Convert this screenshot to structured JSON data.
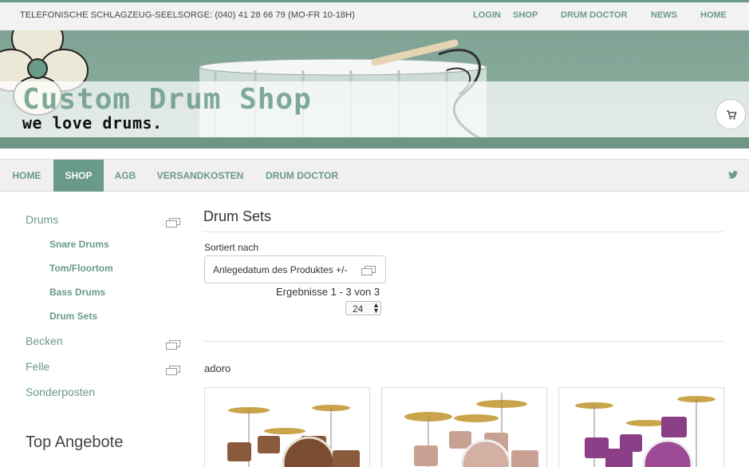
{
  "topbar": {
    "phone": "TELEFONISCHE SCHLAGZEUG-SEELSORGE: (040) 41 28 66 79 (MO-FR 10-18H)",
    "links": [
      "LOGIN",
      "SHOP",
      "DRUM DOCTOR",
      "NEWS",
      "HOME"
    ]
  },
  "banner": {
    "title": "Custom Drum Shop",
    "tagline": "we love drums."
  },
  "mainnav": {
    "items": [
      "HOME",
      "SHOP",
      "AGB",
      "VERSANDKOSTEN",
      "DRUM DOCTOR"
    ],
    "active": "SHOP"
  },
  "sidebar": {
    "categories": [
      {
        "label": "Drums",
        "children": [
          "Snare Drums",
          "Tom/Floortom",
          "Bass Drums",
          "Drum Sets"
        ]
      },
      {
        "label": "Becken"
      },
      {
        "label": "Felle"
      },
      {
        "label": "Sonderposten"
      }
    ],
    "top_offers_heading": "Top Angebote"
  },
  "main": {
    "heading": "Drum Sets",
    "sort_label": "Sortiert nach",
    "sort_value": "Anlegedatum des Produktes +/-",
    "results_text": "Ergebnisse 1 - 3 von 3",
    "per_page": "24",
    "manufacturer": "adoro"
  },
  "colors": {
    "accent": "#6a9a88",
    "drum_finish_1": "#8a5a3c",
    "drum_finish_2": "#c9a193",
    "drum_finish_3": "#8b3f86"
  },
  "icons": [
    "shopping-cart-icon",
    "twitter-icon",
    "expand-icon",
    "select-caret-icon",
    "spinner-arrows-icon"
  ]
}
